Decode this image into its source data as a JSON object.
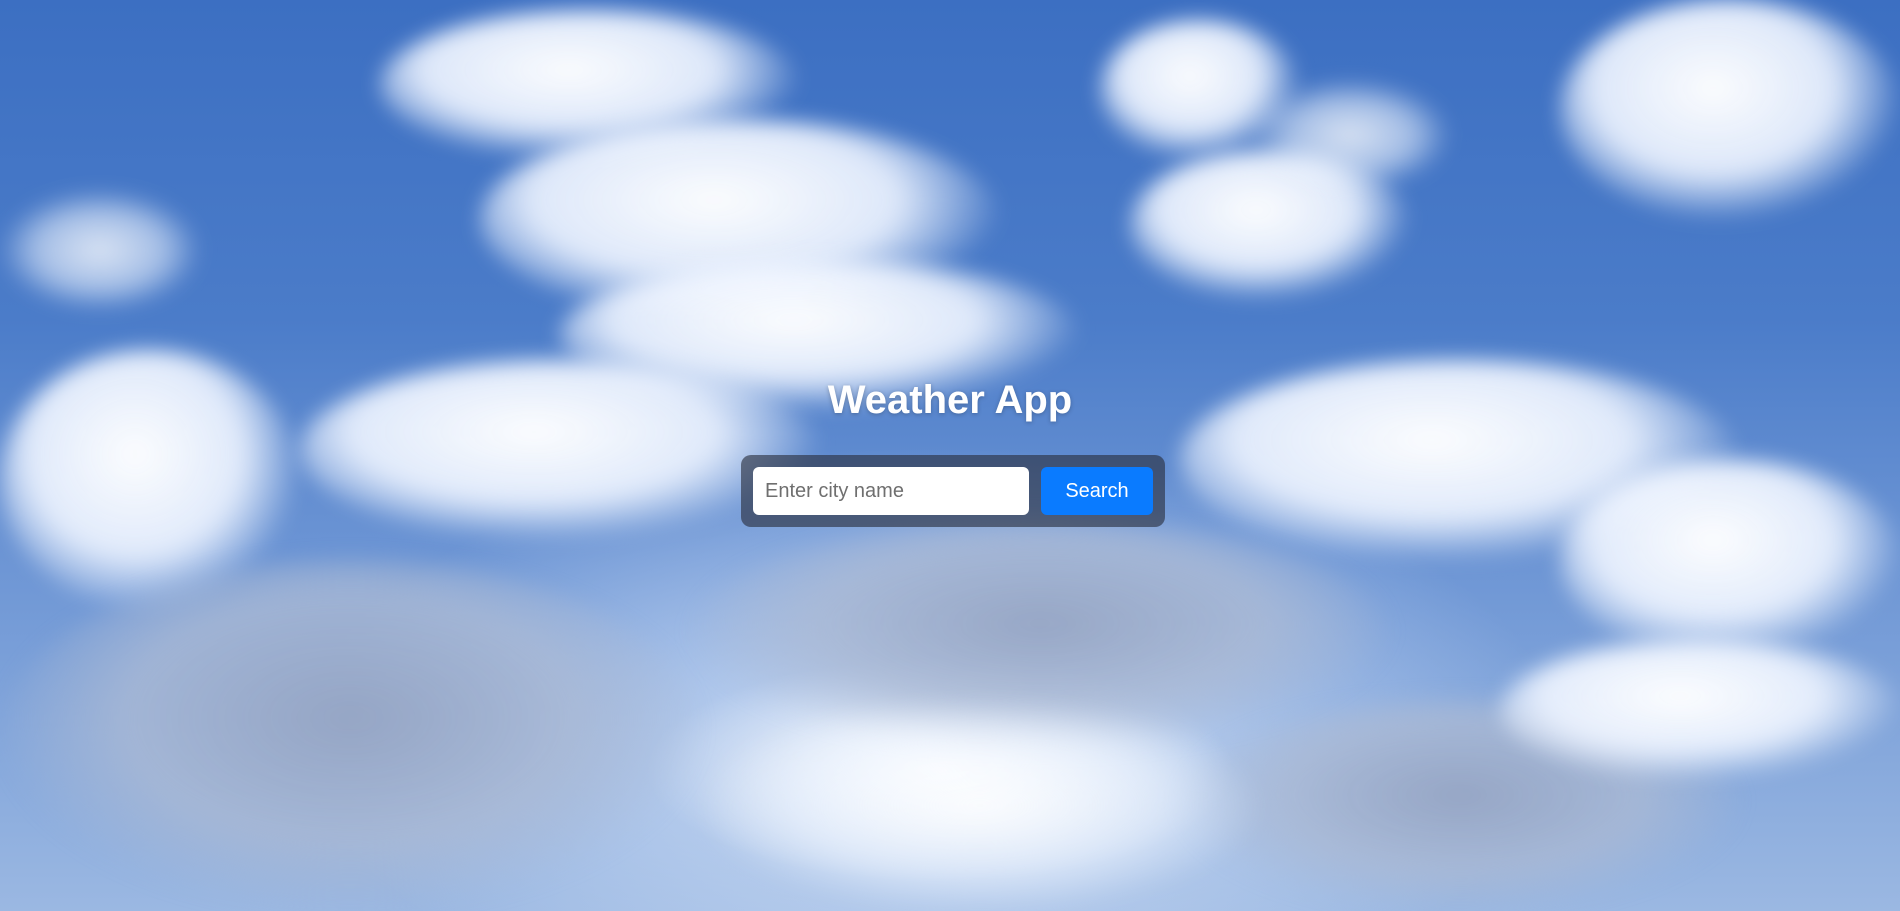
{
  "app": {
    "title": "Weather App"
  },
  "search": {
    "placeholder": "Enter city name",
    "value": "",
    "button_label": "Search"
  },
  "colors": {
    "button_background": "#0a7bff",
    "panel_background": "rgba(40,45,60,0.62)",
    "title_text": "#ffffff"
  }
}
